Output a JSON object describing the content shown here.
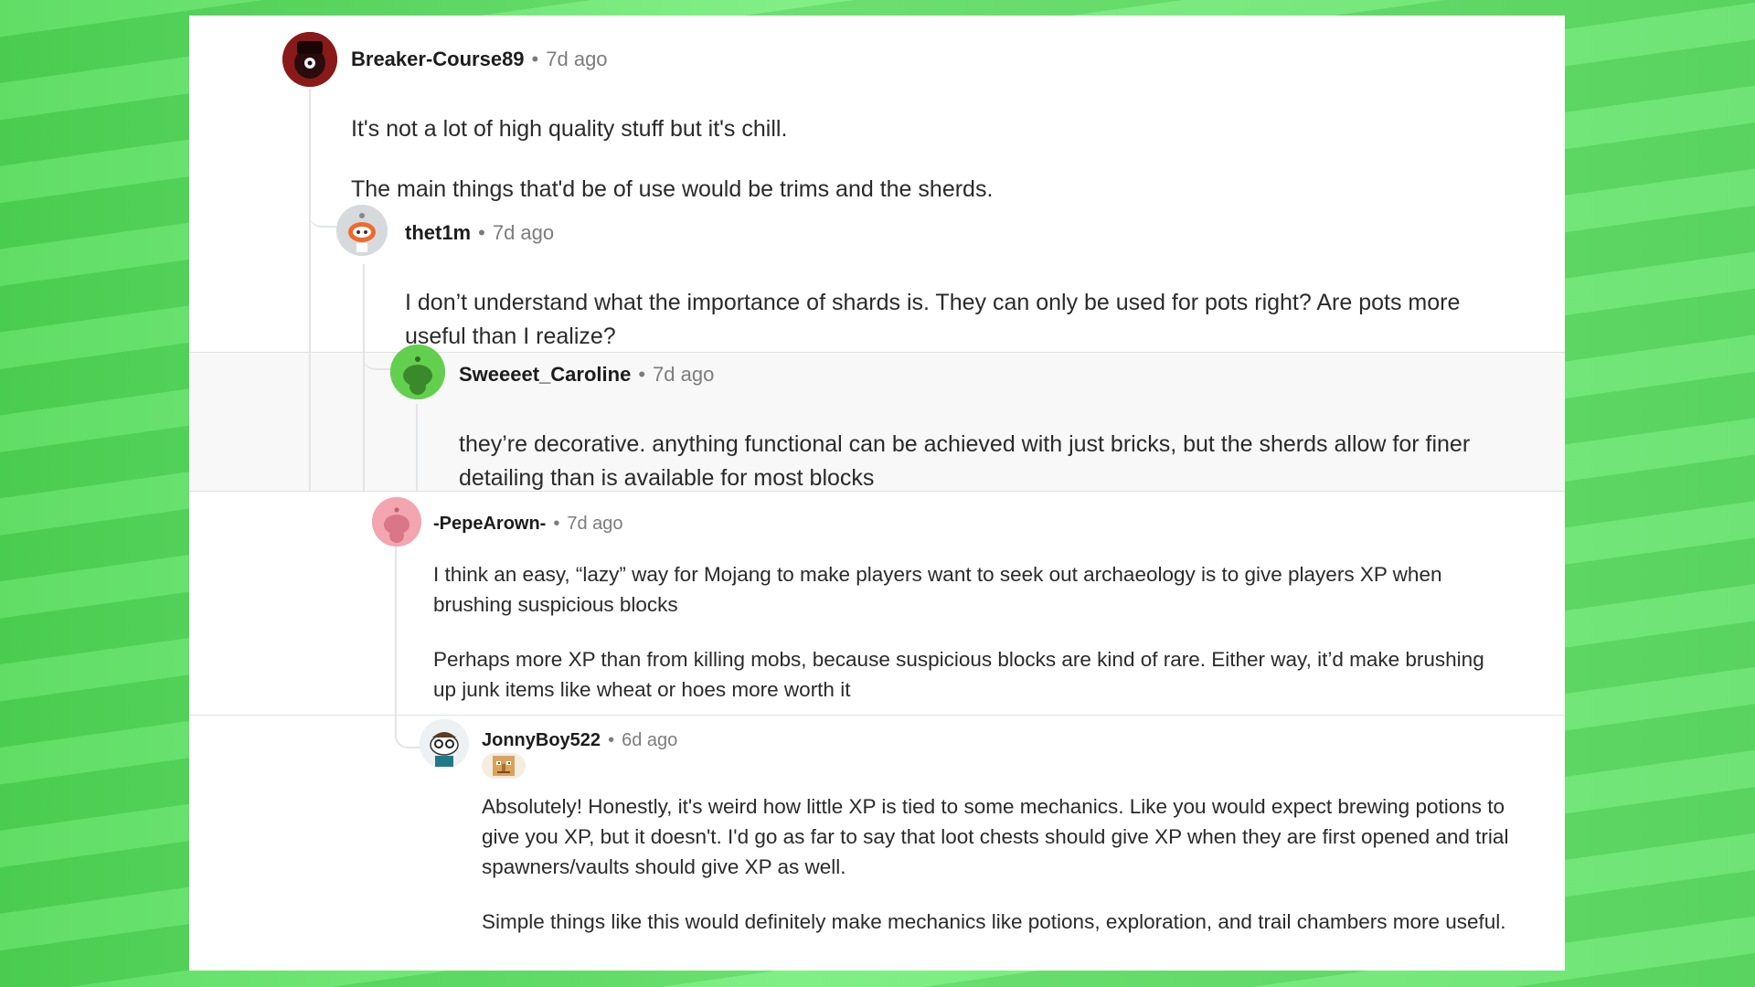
{
  "comments": [
    {
      "author": "Breaker-Course89",
      "separator": "•",
      "time": "7d ago",
      "avatar_icon": "avatar-icon",
      "paragraphs": [
        "It's not a lot of high quality stuff but it's chill.",
        "The main things that'd be of use would be trims and the sherds."
      ]
    },
    {
      "author": "thet1m",
      "separator": "•",
      "time": "7d ago",
      "avatar_icon": "avatar-icon",
      "paragraphs": [
        "I don’t understand what the importance of shards is. They can only be used for pots right? Are pots more useful than I realize?"
      ]
    },
    {
      "author": "Sweeeet_Caroline",
      "separator": "•",
      "time": "7d ago",
      "avatar_icon": "avatar-icon",
      "paragraphs": [
        "they’re decorative. anything functional can be achieved with just bricks, but the sherds allow for finer detailing than is available for most blocks"
      ]
    },
    {
      "author": "-PepeArown-",
      "separator": "•",
      "time": "7d ago",
      "avatar_icon": "avatar-icon",
      "paragraphs": [
        "I think an easy, “lazy” way for Mojang to make players want to seek out archaeology is to give players XP when brushing suspicious blocks",
        "Perhaps more XP than from killing mobs, because suspicious blocks are kind of rare. Either way, it’d make brushing up junk items like wheat or hoes more worth it"
      ]
    },
    {
      "author": "JonnyBoy522",
      "separator": "•",
      "time": "6d ago",
      "avatar_icon": "avatar-icon",
      "flair_icon": "villager-flair-icon",
      "paragraphs": [
        "Absolutely! Honestly, it's weird how little XP is tied to some mechanics. Like you would expect brewing potions to give you XP, but it doesn't. I'd go as far to say that loot chests should give XP when they are first opened and trial spawners/vaults should give XP as well.",
        "Simple things like this would definitely make mechanics like potions, exploration, and trail chambers more useful."
      ]
    }
  ],
  "colors": {
    "background_green": "#5fe066",
    "panel": "#ffffff",
    "thread_line": "#e2e4e6",
    "author_text": "#1c1c1c",
    "meta_text": "#7c7c7c"
  }
}
